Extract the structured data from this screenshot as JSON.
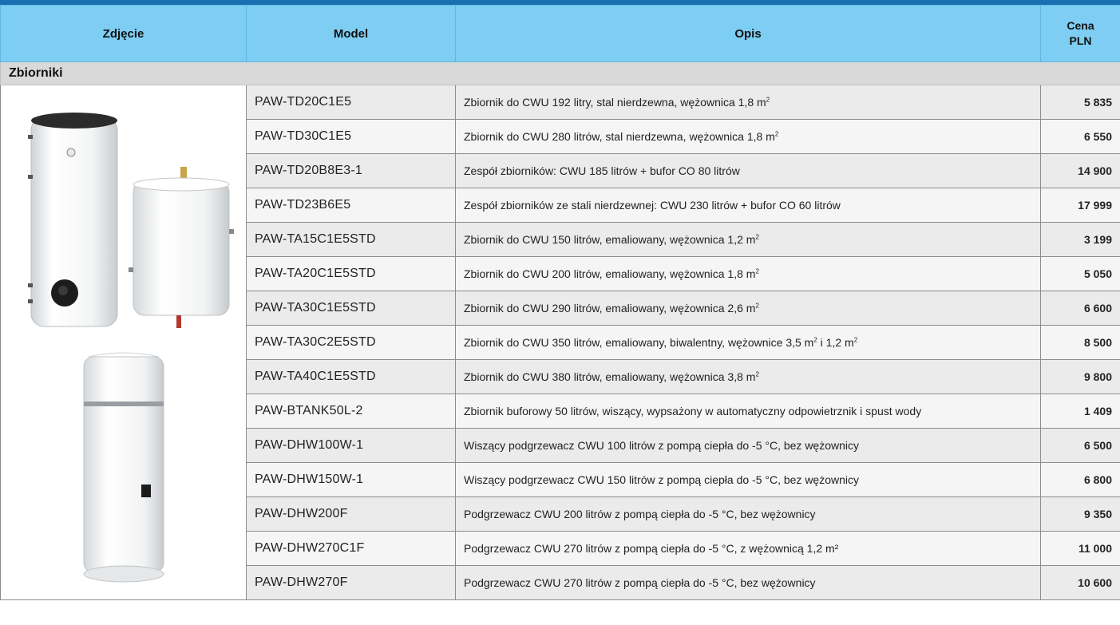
{
  "header": {
    "photo": "Zdjęcie",
    "model": "Model",
    "description": "Opis",
    "price_line1": "Cena",
    "price_line2": "PLN"
  },
  "section": {
    "title": "Zbiorniki"
  },
  "rows": [
    {
      "model": "PAW-TD20C1E5",
      "desc": "Zbiornik do CWU 192 litry, stal nierdzewna, wężownica 1,8 m",
      "sup": "2",
      "desc_tail": "",
      "price": "5 835"
    },
    {
      "model": "PAW-TD30C1E5",
      "desc": "Zbiornik do CWU 280 litrów, stal nierdzewna, wężownica 1,8 m",
      "sup": "2",
      "desc_tail": "",
      "price": "6 550"
    },
    {
      "model": "PAW-TD20B8E3-1",
      "desc": "Zespół zbiorników: CWU 185 litrów + bufor CO 80 litrów",
      "sup": "",
      "desc_tail": "",
      "price": "14 900"
    },
    {
      "model": "PAW-TD23B6E5",
      "desc": "Zespół zbiorników ze stali nierdzewnej: CWU 230 litrów + bufor CO 60 litrów",
      "sup": "",
      "desc_tail": "",
      "price": "17 999"
    },
    {
      "model": "PAW-TA15C1E5STD",
      "desc": "Zbiornik do CWU 150 litrów, emaliowany, wężownica 1,2 m",
      "sup": "2",
      "desc_tail": "",
      "price": "3 199"
    },
    {
      "model": "PAW-TA20C1E5STD",
      "desc": "Zbiornik do CWU 200 litrów, emaliowany, wężownica 1,8 m",
      "sup": "2",
      "desc_tail": "",
      "price": "5 050"
    },
    {
      "model": "PAW-TA30C1E5STD",
      "desc": "Zbiornik do CWU 290 litrów, emaliowany, wężownica 2,6 m",
      "sup": "2",
      "desc_tail": "",
      "price": "6 600"
    },
    {
      "model": "PAW-TA30C2E5STD",
      "desc": "Zbiornik do CWU 350 litrów, emaliowany, biwalentny, wężownice 3,5 m",
      "sup": "2",
      "desc_tail": " i 1,2 m",
      "sup2": "2",
      "price": "8 500"
    },
    {
      "model": "PAW-TA40C1E5STD",
      "desc": "Zbiornik do CWU 380 litrów, emaliowany, wężownica 3,8 m",
      "sup": "2",
      "desc_tail": "",
      "price": "9 800"
    },
    {
      "model": "PAW-BTANK50L-2",
      "desc": "Zbiornik buforowy 50 litrów, wiszący, wypsażony w automatyczny odpowietrznik i spust wody",
      "sup": "",
      "desc_tail": "",
      "price": "1 409"
    },
    {
      "model": "PAW-DHW100W-1",
      "desc": "Wiszący podgrzewacz CWU 100 litrów z pompą ciepła do -5 °C, bez wężownicy",
      "sup": "",
      "desc_tail": "",
      "price": "6 500"
    },
    {
      "model": "PAW-DHW150W-1",
      "desc": "Wiszący podgrzewacz CWU 150 litrów z pompą ciepła do -5 °C, bez wężownicy",
      "sup": "",
      "desc_tail": "",
      "price": "6 800"
    },
    {
      "model": "PAW-DHW200F",
      "desc": "Podgrzewacz CWU 200 litrów z pompą ciepła do -5 °C, bez wężownicy",
      "sup": "",
      "desc_tail": "",
      "price": "9 350"
    },
    {
      "model": "PAW-DHW270C1F",
      "desc": "Podgrzewacz CWU 270 litrów z pompą ciepła do -5 °C, z wężownicą 1,2 m²",
      "sup": "",
      "desc_tail": "",
      "price": "11 000"
    },
    {
      "model": "PAW-DHW270F",
      "desc": "Podgrzewacz CWU 270 litrów z pompą ciepła do -5 °C, bez wężownicy",
      "sup": "",
      "desc_tail": "",
      "price": "10 600"
    }
  ],
  "colors": {
    "header_bg": "#7ecdf2",
    "topbar": "#1a6fb0",
    "section_bg": "#d9d9d9"
  }
}
